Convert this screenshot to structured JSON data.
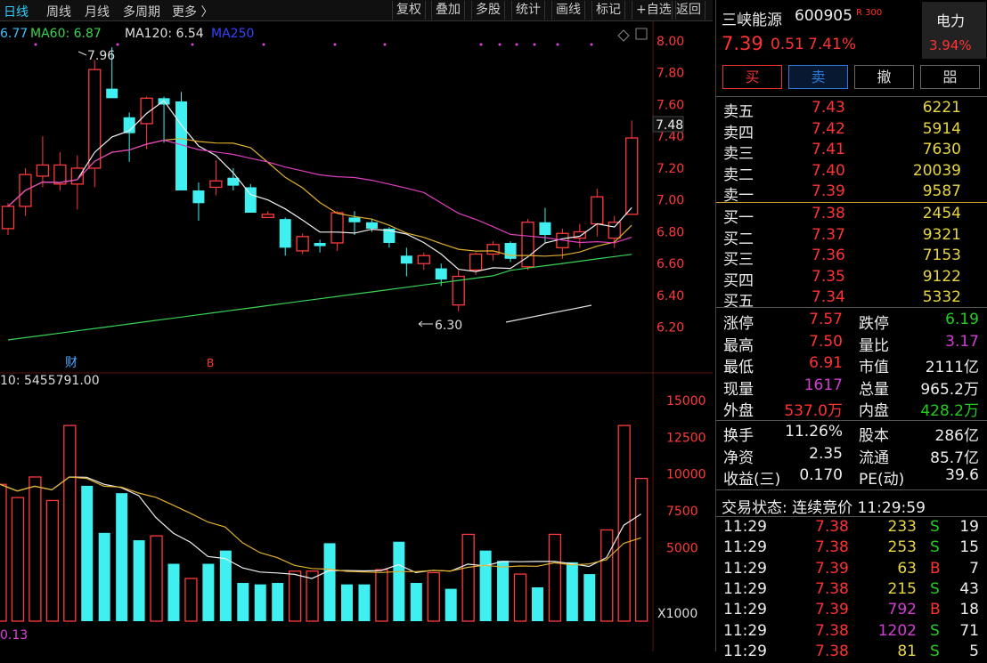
{
  "toolbar": {
    "periods": [
      "日线",
      "周线",
      "月线",
      "多周期",
      "更多 〉"
    ],
    "tools": [
      "复权",
      "叠加",
      "多股",
      "统计",
      "画线",
      "标记",
      "+自选",
      "返回"
    ]
  },
  "ma_legend": [
    {
      "label": "6.77",
      "color": "#3cc0ff"
    },
    {
      "label": "MA60: 6.87",
      "color": "#39d353"
    },
    {
      "label": "MA120: 6.54",
      "color": "#e0e0e0"
    },
    {
      "label": "MA250",
      "color": "#3344ff"
    }
  ],
  "chart_data": {
    "type": "candlestick",
    "price_axis_ticks": [
      "8.00",
      "7.80",
      "7.60",
      "7.40",
      "7.20",
      "7.00",
      "6.80",
      "6.60",
      "6.40",
      "6.20"
    ],
    "price_ylim": [
      6.12,
      8.0
    ],
    "current_price_marker": "7.48",
    "annotations": {
      "high": "7.96",
      "low": "6.30"
    },
    "event_markers": [
      "财",
      "B"
    ],
    "candles": [
      [
        6.82,
        6.98,
        6.78,
        6.96,
        "up"
      ],
      [
        6.96,
        7.2,
        6.9,
        7.16,
        "up"
      ],
      [
        7.15,
        7.4,
        7.08,
        7.22,
        "up"
      ],
      [
        7.22,
        7.3,
        7.06,
        7.1,
        "up"
      ],
      [
        7.1,
        7.28,
        6.94,
        7.2,
        "up"
      ],
      [
        7.2,
        7.88,
        7.08,
        7.82,
        "up"
      ],
      [
        7.7,
        7.96,
        7.64,
        7.64,
        "down"
      ],
      [
        7.52,
        7.55,
        7.24,
        7.42,
        "down"
      ],
      [
        7.48,
        7.65,
        7.32,
        7.64,
        "up"
      ],
      [
        7.64,
        7.65,
        7.36,
        7.6,
        "down"
      ],
      [
        7.62,
        7.68,
        7.06,
        7.06,
        "down"
      ],
      [
        7.06,
        7.11,
        6.87,
        6.98,
        "down"
      ],
      [
        7.08,
        7.25,
        7.03,
        7.12,
        "up"
      ],
      [
        7.14,
        7.2,
        7.06,
        7.09,
        "down"
      ],
      [
        7.08,
        7.1,
        6.92,
        6.92,
        "down"
      ],
      [
        6.91,
        6.93,
        6.89,
        6.89,
        "up"
      ],
      [
        6.88,
        6.89,
        6.65,
        6.7,
        "down"
      ],
      [
        6.68,
        6.79,
        6.66,
        6.77,
        "up"
      ],
      [
        6.73,
        6.75,
        6.67,
        6.71,
        "down"
      ],
      [
        6.73,
        6.93,
        6.68,
        6.92,
        "up"
      ],
      [
        6.89,
        6.93,
        6.78,
        6.86,
        "down"
      ],
      [
        6.86,
        6.88,
        6.8,
        6.82,
        "down"
      ],
      [
        6.82,
        6.83,
        6.7,
        6.73,
        "down"
      ],
      [
        6.65,
        6.7,
        6.52,
        6.6,
        "down"
      ],
      [
        6.6,
        6.67,
        6.56,
        6.65,
        "up"
      ],
      [
        6.57,
        6.6,
        6.46,
        6.5,
        "down"
      ],
      [
        6.52,
        6.56,
        6.3,
        6.34,
        "up"
      ],
      [
        6.56,
        6.67,
        6.53,
        6.66,
        "up"
      ],
      [
        6.66,
        6.74,
        6.62,
        6.72,
        "up"
      ],
      [
        6.73,
        6.74,
        6.61,
        6.63,
        "down"
      ],
      [
        6.58,
        6.88,
        6.56,
        6.86,
        "up"
      ],
      [
        6.86,
        6.95,
        6.73,
        6.78,
        "down"
      ],
      [
        6.7,
        6.82,
        6.63,
        6.79,
        "up"
      ],
      [
        6.76,
        6.85,
        6.7,
        6.8,
        "up"
      ],
      [
        6.85,
        7.07,
        6.77,
        7.02,
        "up"
      ],
      [
        6.86,
        6.9,
        6.7,
        6.76,
        "up"
      ],
      [
        6.91,
        7.5,
        6.91,
        7.39,
        "up"
      ]
    ],
    "volume_axis_ticks": [
      "15000",
      "12500",
      "10000",
      "7500",
      "5000"
    ],
    "volume_unit": "X1000",
    "volume_ylim": [
      0,
      15000
    ],
    "volume_header": "10: 5455791.00",
    "volume_footer": "0.13",
    "volumes": [
      [
        9300,
        "up"
      ],
      [
        8400,
        "up"
      ],
      [
        9800,
        "up"
      ],
      [
        8200,
        "up"
      ],
      [
        13300,
        "up"
      ],
      [
        9200,
        "down"
      ],
      [
        6000,
        "down"
      ],
      [
        8700,
        "down"
      ],
      [
        5500,
        "down"
      ],
      [
        5800,
        "up"
      ],
      [
        3900,
        "down"
      ],
      [
        2900,
        "up"
      ],
      [
        3900,
        "down"
      ],
      [
        4800,
        "down"
      ],
      [
        2600,
        "down"
      ],
      [
        2500,
        "down"
      ],
      [
        2600,
        "down"
      ],
      [
        3400,
        "up"
      ],
      [
        3400,
        "up"
      ],
      [
        5300,
        "down"
      ],
      [
        2500,
        "down"
      ],
      [
        2500,
        "down"
      ],
      [
        3500,
        "up"
      ],
      [
        5400,
        "down"
      ],
      [
        2600,
        "down"
      ],
      [
        3300,
        "up"
      ],
      [
        2200,
        "down"
      ],
      [
        5900,
        "up"
      ],
      [
        4800,
        "down"
      ],
      [
        4100,
        "down"
      ],
      [
        3200,
        "up"
      ],
      [
        2300,
        "down"
      ],
      [
        5900,
        "up"
      ],
      [
        4000,
        "down"
      ],
      [
        3200,
        "down"
      ],
      [
        6200,
        "up"
      ],
      [
        13300,
        "up"
      ],
      [
        9700,
        "up"
      ]
    ]
  },
  "stock": {
    "name": "三峡能源",
    "code": "600905",
    "tag": "R 300",
    "price": "7.39",
    "change": "0.51",
    "change_pct": "7.41%",
    "sector": "电力",
    "sector_pct": "3.94%"
  },
  "buttons": {
    "buy": "买",
    "sell": "卖",
    "cancel": "撤",
    "more": "㗊"
  },
  "orderbook": {
    "asks": [
      {
        "label": "卖五",
        "price": "7.43",
        "vol": "6221"
      },
      {
        "label": "卖四",
        "price": "7.42",
        "vol": "5914"
      },
      {
        "label": "卖三",
        "price": "7.41",
        "vol": "7630"
      },
      {
        "label": "卖二",
        "price": "7.40",
        "vol": "20039"
      },
      {
        "label": "卖一",
        "price": "7.39",
        "vol": "9587"
      }
    ],
    "bids": [
      {
        "label": "买一",
        "price": "7.38",
        "vol": "2454"
      },
      {
        "label": "买二",
        "price": "7.37",
        "vol": "9321"
      },
      {
        "label": "买三",
        "price": "7.36",
        "vol": "7153"
      },
      {
        "label": "买四",
        "price": "7.35",
        "vol": "9122"
      },
      {
        "label": "买五",
        "price": "7.34",
        "vol": "5332"
      }
    ]
  },
  "stats": [
    {
      "l1": "涨停",
      "v1": "7.57",
      "c1": "red",
      "l2": "跌停",
      "v2": "6.19",
      "c2": "grn"
    },
    {
      "l1": "最高",
      "v1": "7.50",
      "c1": "red",
      "l2": "量比",
      "v2": "3.17",
      "c2": "mag"
    },
    {
      "l1": "最低",
      "v1": "6.91",
      "c1": "red",
      "l2": "市值",
      "v2": "2111亿",
      "c2": "wht"
    },
    {
      "l1": "现量",
      "v1": "1617",
      "c1": "mag",
      "l2": "总量",
      "v2": "965.2万",
      "c2": "wht"
    },
    {
      "l1": "外盘",
      "v1": "537.0万",
      "c1": "red",
      "l2": "内盘",
      "v2": "428.2万",
      "c2": "grn"
    }
  ],
  "stats2": [
    {
      "l1": "换手",
      "v1": "11.26%",
      "l2": "股本",
      "v2": "286亿"
    },
    {
      "l1": "净资",
      "v1": "2.35",
      "l2": "流通",
      "v2": "85.7亿"
    },
    {
      "l1": "收益(三)",
      "v1": "0.170",
      "l2": "PE(动)",
      "v2": "39.6"
    }
  ],
  "trade_status": "交易状态: 连续竞价 11:29:59",
  "ticks": [
    {
      "time": "11:29",
      "price": "7.38",
      "vol": "233",
      "side": "S",
      "num": "19",
      "vc": "yel"
    },
    {
      "time": "11:29",
      "price": "7.38",
      "vol": "253",
      "side": "S",
      "num": "15",
      "vc": "yel"
    },
    {
      "time": "11:29",
      "price": "7.39",
      "vol": "63",
      "side": "B",
      "num": "7",
      "vc": "yel"
    },
    {
      "time": "11:29",
      "price": "7.38",
      "vol": "215",
      "side": "S",
      "num": "43",
      "vc": "yel"
    },
    {
      "time": "11:29",
      "price": "7.39",
      "vol": "792",
      "side": "B",
      "num": "18",
      "vc": "mag"
    },
    {
      "time": "11:29",
      "price": "7.38",
      "vol": "1202",
      "side": "S",
      "num": "71",
      "vc": "mag"
    },
    {
      "time": "11:29",
      "price": "7.38",
      "vol": "81",
      "side": "S",
      "num": "5",
      "vc": "yel"
    }
  ]
}
